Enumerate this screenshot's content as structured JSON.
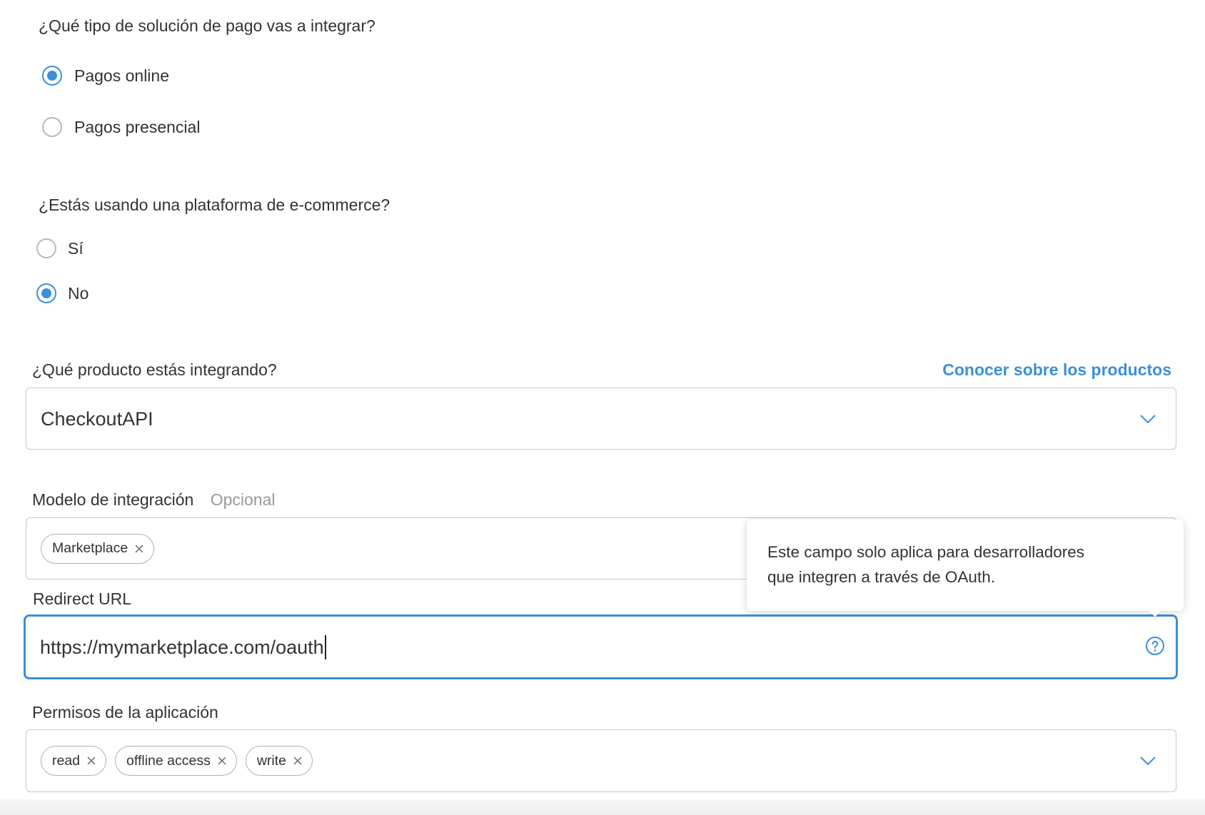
{
  "payment_solution": {
    "question": "¿Qué tipo de solución de pago vas a integrar?",
    "options": [
      {
        "label": "Pagos online",
        "checked": true
      },
      {
        "label": "Pagos presencial",
        "checked": false
      }
    ]
  },
  "ecommerce_platform": {
    "question": "¿Estás usando una plataforma de e-commerce?",
    "options": [
      {
        "label": "Sí",
        "checked": false
      },
      {
        "label": "No",
        "checked": true
      }
    ]
  },
  "product": {
    "label": "¿Qué producto estás integrando?",
    "link": "Conocer sobre los productos",
    "selected_value": "CheckoutAPI",
    "dropdown_icon": "chevron-down-icon"
  },
  "integration_model": {
    "label": "Modelo de integración",
    "optional_hint": "Opcional",
    "tags": [
      "Marketplace"
    ],
    "tag_remove_icon": "close-icon"
  },
  "tooltip": {
    "lines": [
      "Este campo solo aplica para desarrolladores",
      "que integren a través de OAuth."
    ]
  },
  "redirect_url": {
    "label": "Redirect URL",
    "value": "https://mymarketplace.com/oauth",
    "focused": true,
    "help_icon": "question-circle-icon"
  },
  "permissions": {
    "label": "Permisos de la aplicación",
    "tags": [
      "read",
      "offline access",
      "write"
    ],
    "tag_remove_icon": "close-icon",
    "dropdown_icon": "chevron-down-icon"
  },
  "colors": {
    "accent": "#3b8fd8",
    "text": "#333333",
    "muted": "#999999",
    "border": "#c8c8c8"
  }
}
